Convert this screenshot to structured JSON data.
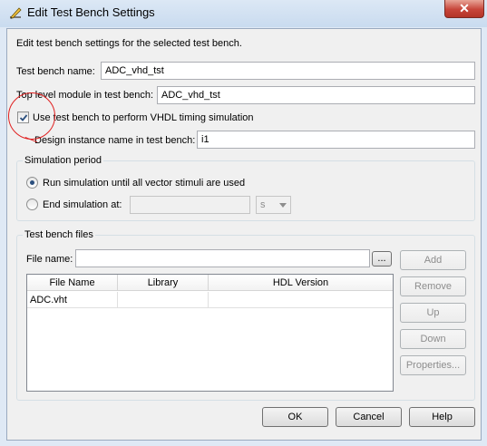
{
  "window": {
    "title": "Edit Test Bench Settings",
    "close_symbol": "✕"
  },
  "description": "Edit test bench settings for the selected test bench.",
  "fields": {
    "test_bench_name_label": "Test bench name:",
    "test_bench_name_value": "ADC_vhd_tst",
    "top_level_label": "Top level module in test bench:",
    "top_level_value": "ADC_vhd_tst",
    "use_timing_label": "Use test bench to perform VHDL timing simulation",
    "use_timing_checked": true,
    "instance_label": "Design instance name in test bench:",
    "instance_value": "i1"
  },
  "simulation_period": {
    "title": "Simulation period",
    "run_until_label": "Run simulation until all vector stimuli are used",
    "end_at_label": "End simulation at:",
    "end_at_value": "",
    "unit_value": "s",
    "selected": "run_until"
  },
  "test_bench_files": {
    "title": "Test bench files",
    "file_name_label": "File name:",
    "file_name_value": "",
    "browse_label": "...",
    "columns": [
      "File Name",
      "Library",
      "HDL Version"
    ],
    "rows": [
      [
        "ADC.vht",
        "",
        ""
      ]
    ],
    "buttons": {
      "add": "Add",
      "remove": "Remove",
      "up": "Up",
      "down": "Down",
      "properties": "Properties..."
    }
  },
  "footer": {
    "ok": "OK",
    "cancel": "Cancel",
    "help": "Help"
  },
  "colors": {
    "annotation": "#e02020",
    "selection": "#2b4f7e"
  }
}
